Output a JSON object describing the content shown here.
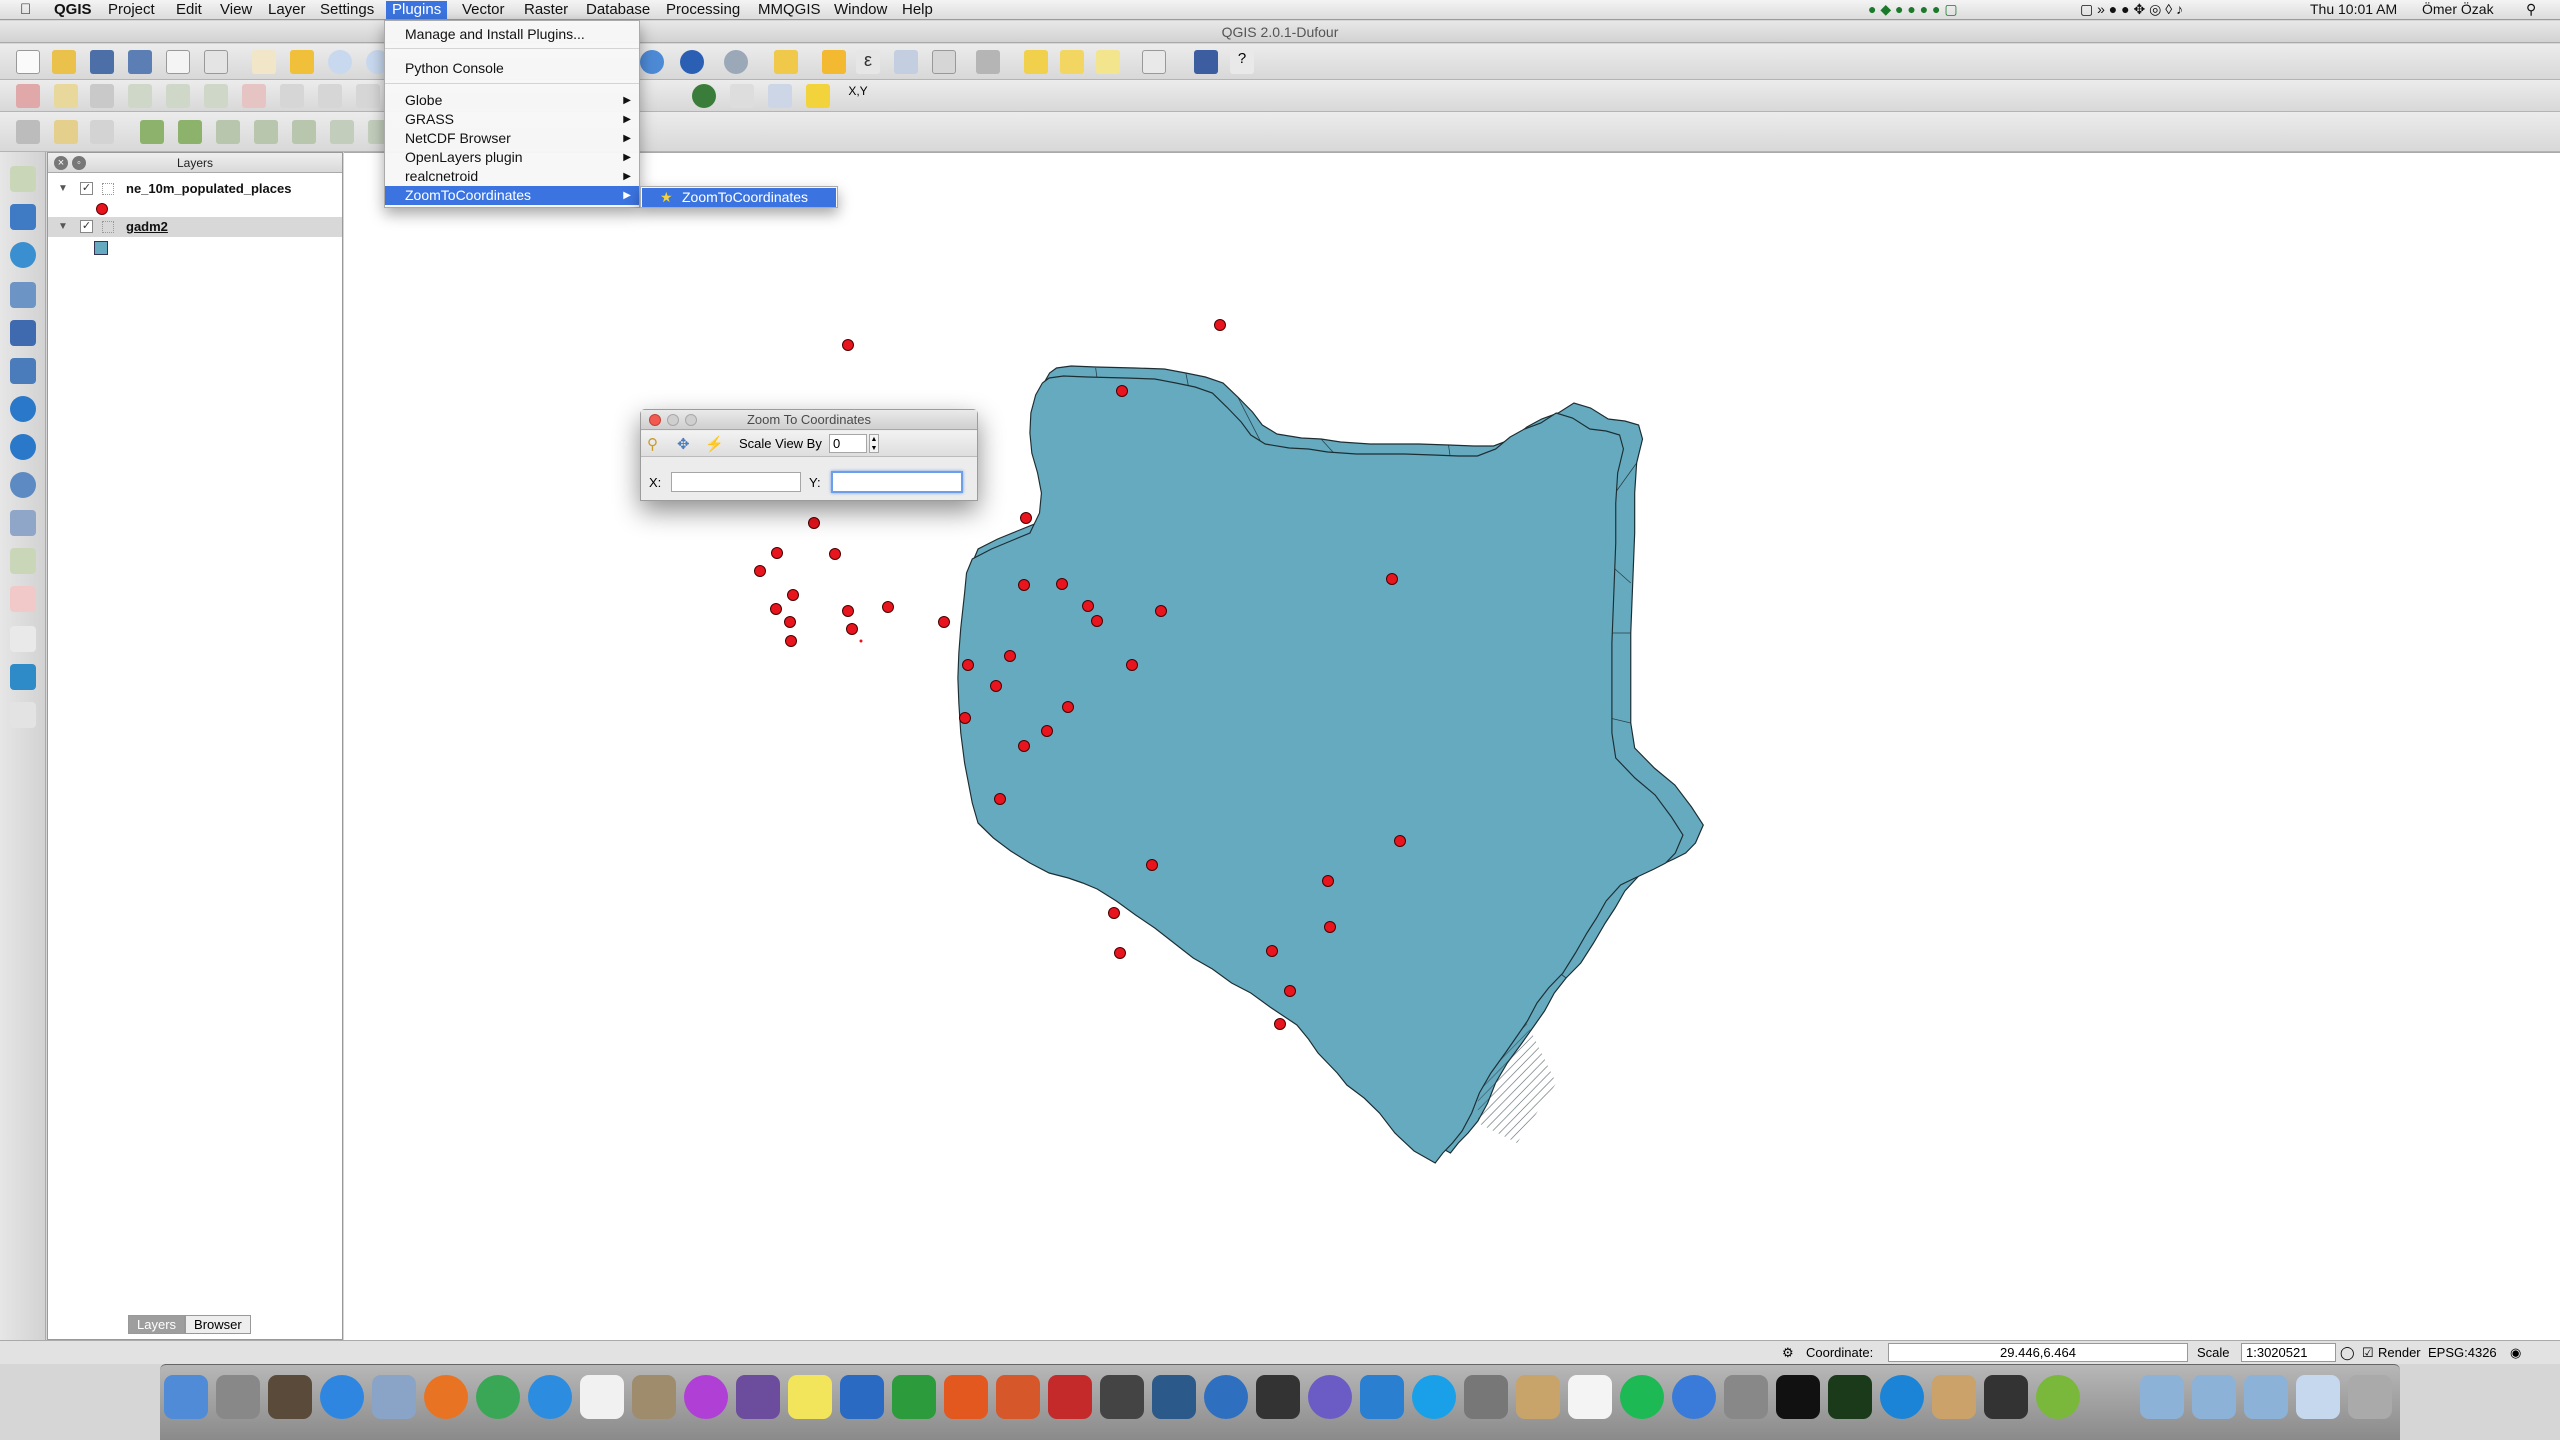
{
  "menubar": {
    "app": "QGIS",
    "items": [
      "Project",
      "Edit",
      "View",
      "Layer",
      "Settings",
      "Plugins",
      "Vector",
      "Raster",
      "Database",
      "Processing",
      "MMQGIS",
      "Window",
      "Help"
    ],
    "active": "Plugins",
    "clock": "Thu 10:01 AM",
    "user": "Ömer Özak"
  },
  "window": {
    "title": "QGIS 2.0.1-Dufour"
  },
  "plugins_menu": {
    "items": [
      {
        "label": "Manage and Install Plugins...",
        "submenu": false
      },
      {
        "label": "Python Console",
        "submenu": false
      },
      {
        "label": "Globe",
        "submenu": true
      },
      {
        "label": "GRASS",
        "submenu": true
      },
      {
        "label": "NetCDF Browser",
        "submenu": true
      },
      {
        "label": "OpenLayers plugin",
        "submenu": true
      },
      {
        "label": "realcnetroid",
        "submenu": true
      },
      {
        "label": "ZoomToCoordinates",
        "submenu": true
      }
    ],
    "selected": "ZoomToCoordinates",
    "submenu_item": "ZoomToCoordinates"
  },
  "layers_panel": {
    "title": "Layers",
    "layers": [
      {
        "name": "ne_10m_populated_places",
        "checked": true,
        "symbol": "red point"
      },
      {
        "name": "gadm2",
        "checked": true,
        "symbol": "teal polygon"
      }
    ],
    "tabs": [
      "Layers",
      "Browser"
    ],
    "active_tab": "Layers"
  },
  "zoom_dialog": {
    "title": "Zoom To Coordinates",
    "scale_label": "Scale View By",
    "scale_value": "0",
    "x_label": "X:",
    "y_label": "Y:",
    "x_value": "",
    "y_value": ""
  },
  "statusbar": {
    "coordinate_label": "Coordinate:",
    "coordinate_value": "29.446,6.464",
    "scale_label": "Scale",
    "scale_value": "1:3020521",
    "render_label": "Render",
    "crs": "EPSG:4326"
  },
  "colors": {
    "map_fill": "#66aabf",
    "point": "#e8141e",
    "highlight": "#3b74e0"
  }
}
